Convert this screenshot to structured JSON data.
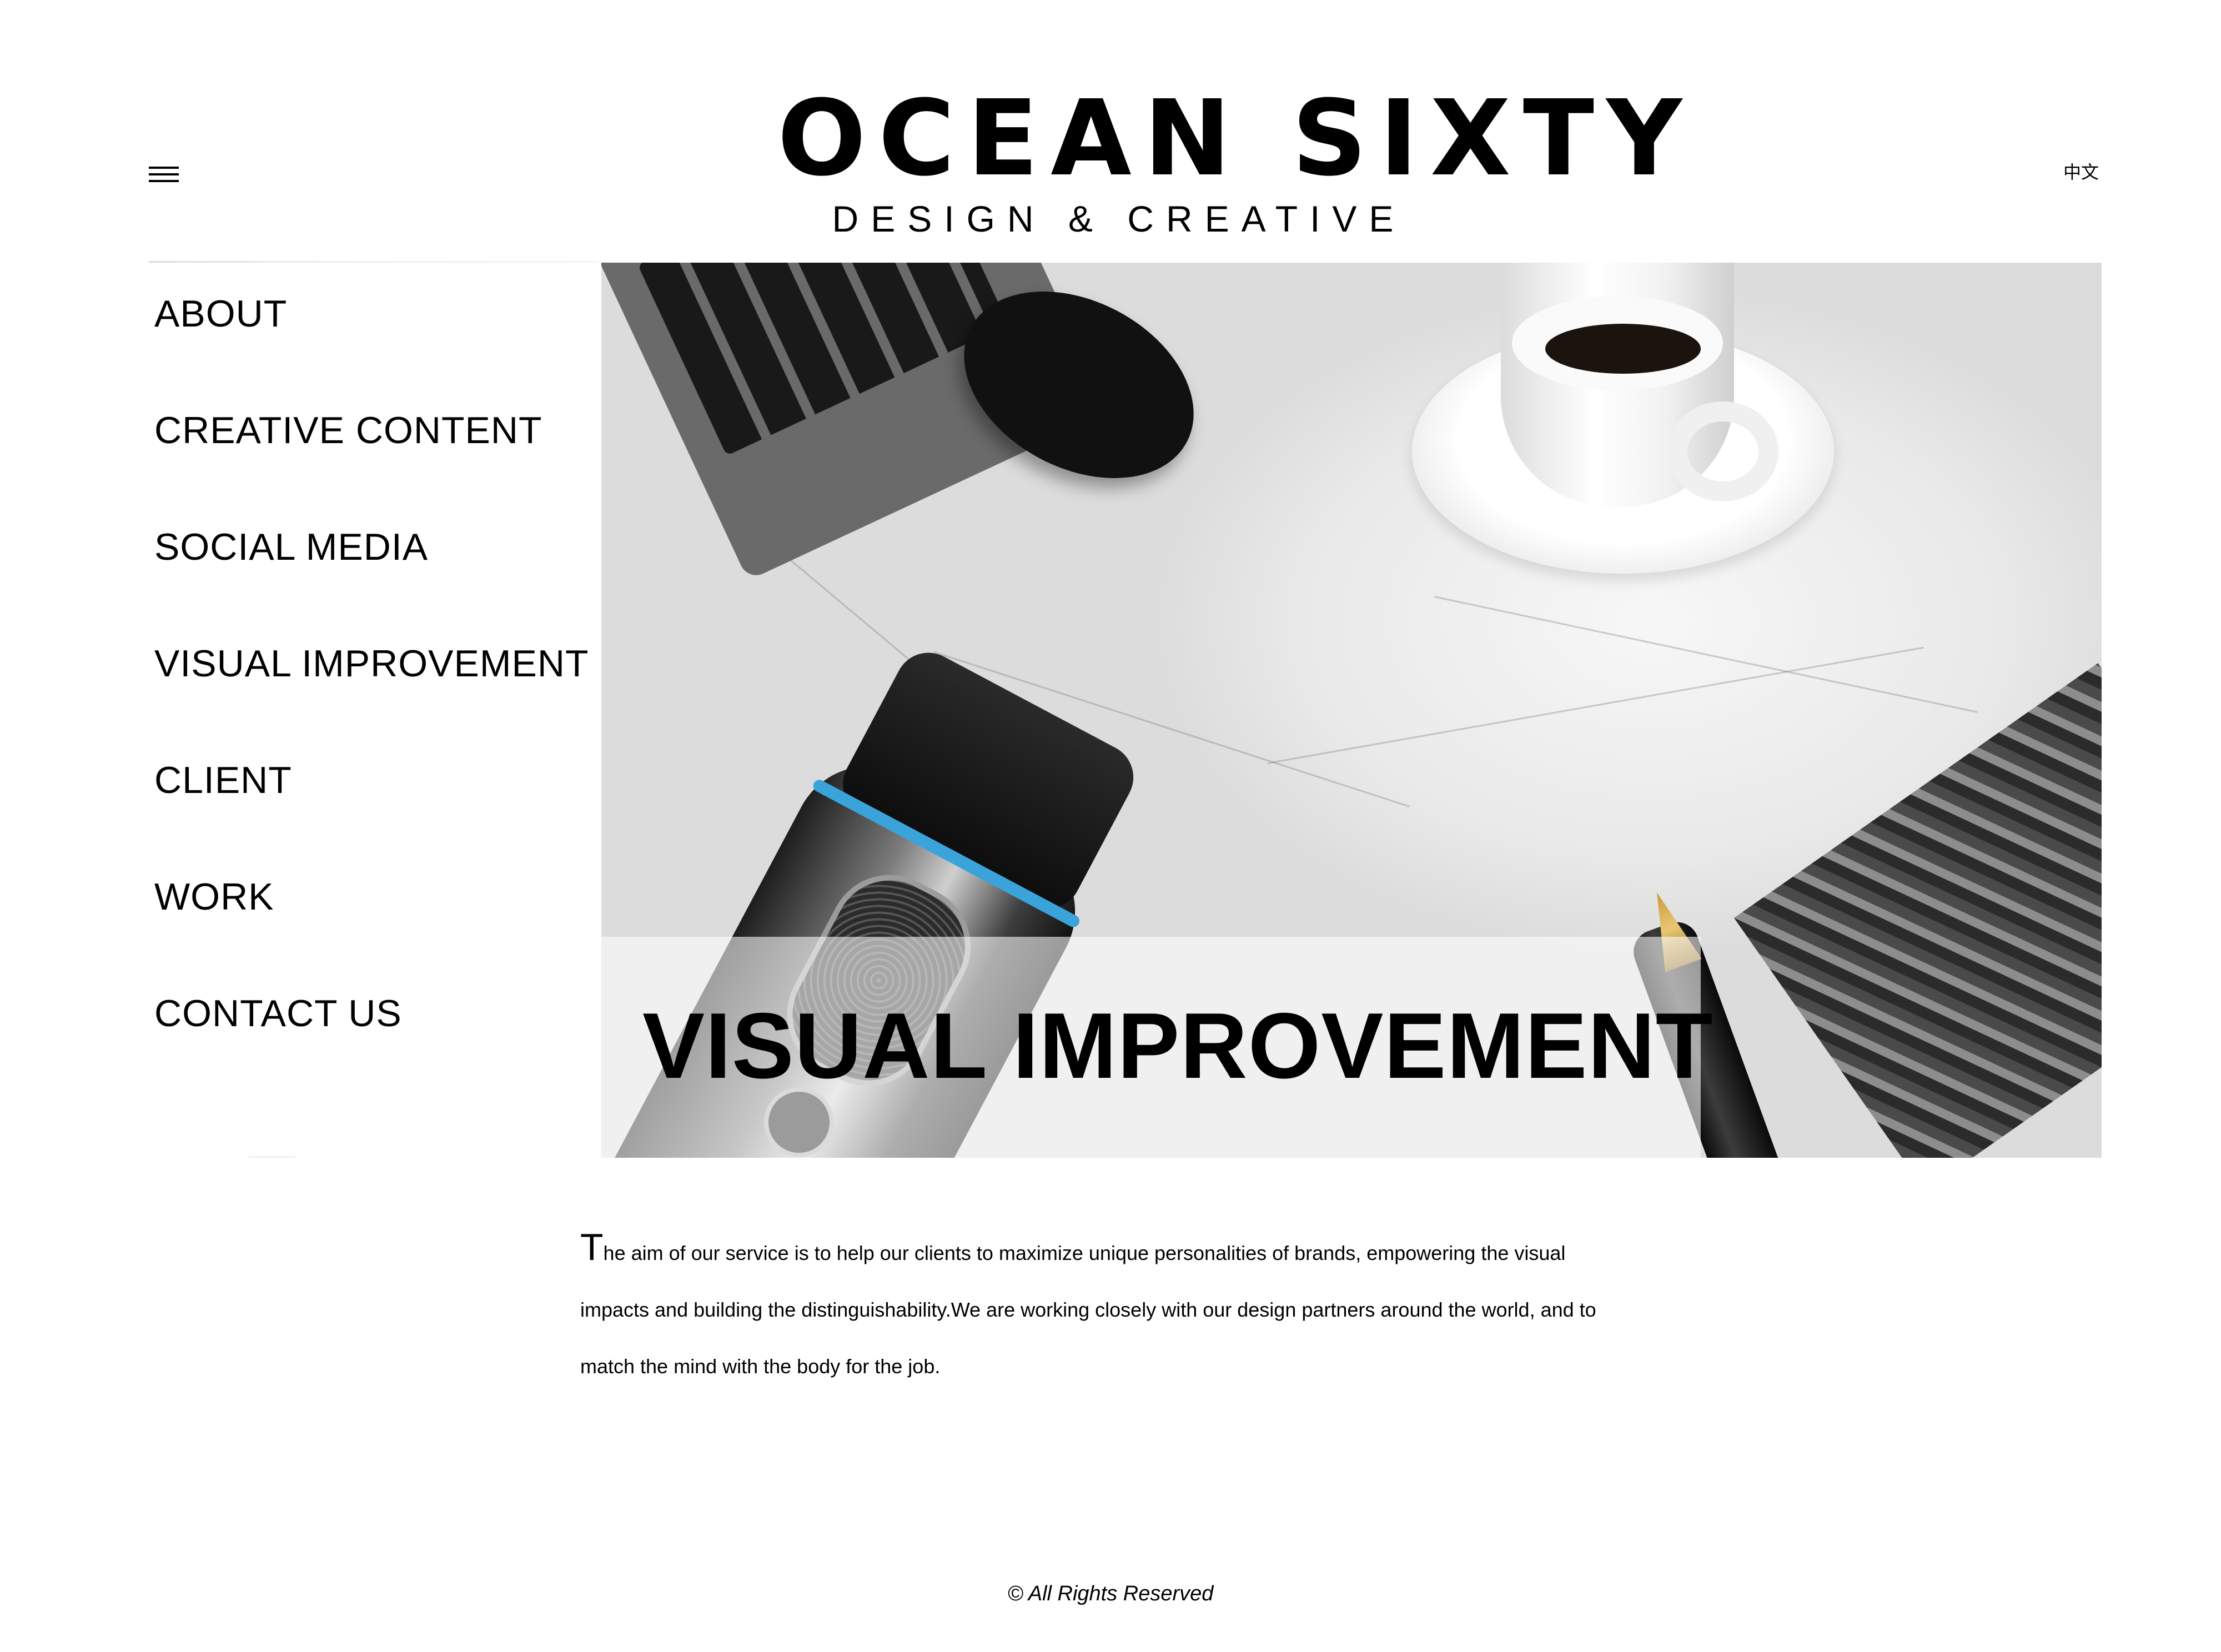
{
  "header": {
    "menu_icon": "hamburger-menu-icon",
    "logo_main": "OCEAN SIXTY",
    "logo_sub": "DESIGN & CREATIVE",
    "lang_switch": "中文"
  },
  "nav": {
    "items": [
      {
        "label": "ABOUT"
      },
      {
        "label": "CREATIVE CONTENT"
      },
      {
        "label": "SOCIAL MEDIA"
      },
      {
        "label": "VISUAL IMPROVEMENT"
      },
      {
        "label": "CLIENT"
      },
      {
        "label": "WORK"
      },
      {
        "label": "CONTACT US"
      }
    ]
  },
  "hero": {
    "title": "VISUAL IMPROVEMENT"
  },
  "content": {
    "dropcap": "T",
    "paragraph": "he aim of our service is to help our clients to maximize unique personalities of brands, empowering the visual impacts and building the distinguishability.We are working closely with our design partners around the world, and to match the mind with the body for the job."
  },
  "footer": {
    "copyright": "© All Rights Reserved"
  },
  "colors": {
    "text": "#000000",
    "background": "#ffffff",
    "shaver_accent": "#3aa3d9"
  }
}
